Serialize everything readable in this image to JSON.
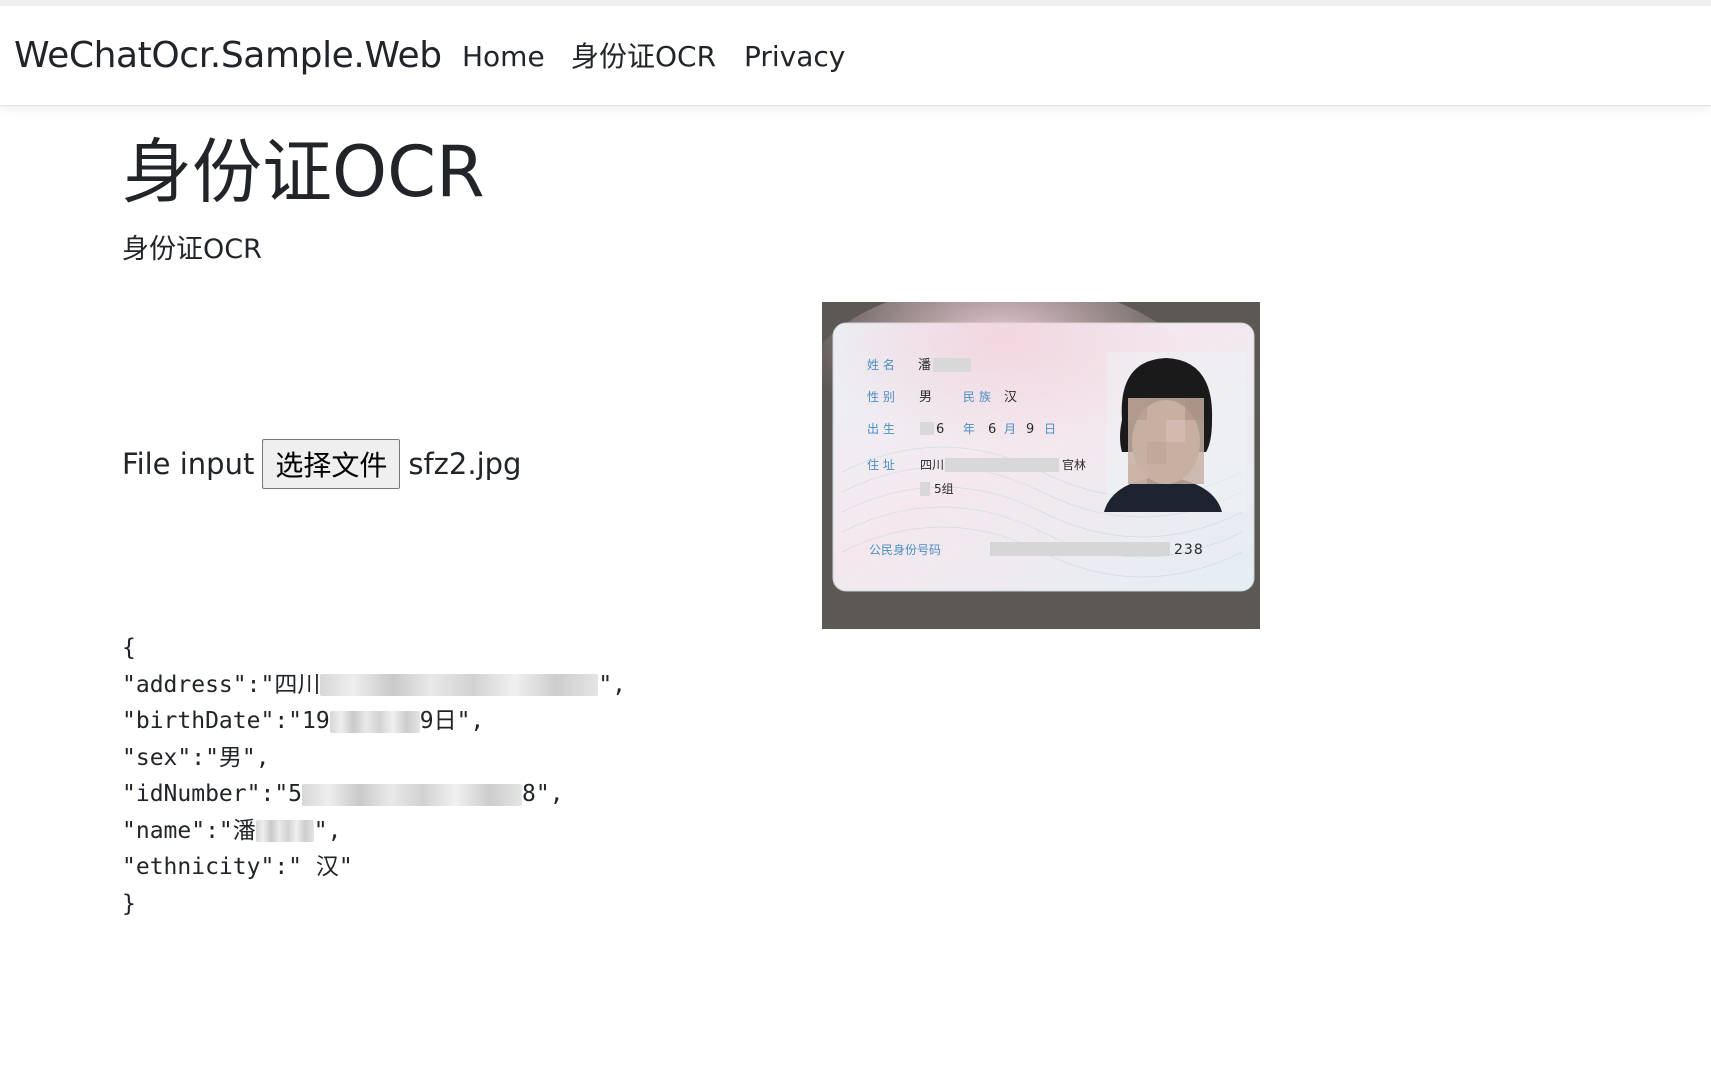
{
  "navbar": {
    "brand": "WeChatOcr.Sample.Web",
    "links": [
      "Home",
      "身份证OCR",
      "Privacy"
    ]
  },
  "main": {
    "title": "身份证OCR",
    "subtitle": "身份证OCR",
    "file_input": {
      "label": "File input",
      "button_label": "选择文件",
      "file_name": "sfz2.jpg"
    }
  },
  "id_card": {
    "labels": {
      "name": "姓 名",
      "sex": "性 别",
      "ethnicity": "民 族",
      "birth": "出 生",
      "address": "住 址",
      "id_number": "公民身份号码"
    },
    "values": {
      "name_visible": "潘",
      "sex": "男",
      "ethnicity": "汉",
      "birth_year_suffix": "6",
      "birth_year_char": "年",
      "birth_month": "6",
      "birth_month_char": "月",
      "birth_day": "9",
      "birth_day_char": "日",
      "address_line1_start": "四川",
      "address_line1_end": "官林",
      "address_line2": "5组",
      "id_number_tail": "238"
    }
  },
  "ocr_result": {
    "open_brace": "{",
    "close_brace": "}",
    "address_key": "\"address\":\"",
    "address_visible": "四川",
    "address_close": "\",",
    "birthdate_key": "\"birthDate\":\"",
    "birthdate_visible_start": "19",
    "birthdate_visible_end": "9日",
    "birthdate_close": "\",",
    "sex_line": "\"sex\":\"男\",",
    "idnumber_key": "\"idNumber\":\"",
    "idnumber_visible_start": "5",
    "idnumber_visible_end": "8",
    "idnumber_close": "\",",
    "name_key": "\"name\":\"",
    "name_visible": "潘",
    "name_close": "\",",
    "ethnicity_line": "\"ethnicity\":\" 汉\""
  }
}
